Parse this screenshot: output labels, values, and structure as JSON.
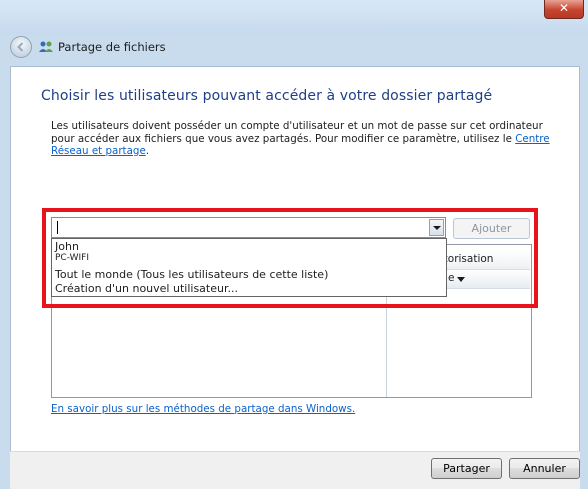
{
  "window": {
    "title": "Partage de fichiers",
    "close_label": "✕"
  },
  "heading": "Choisir les utilisateurs pouvant accéder à votre dossier partagé",
  "description": {
    "text": "Les utilisateurs doivent posséder un compte d'utilisateur et un mot de passe sur cet ordinateur pour accéder aux fichiers que vous avez partagés. Pour modifier ce paramètre, utilisez le ",
    "link": "Centre Réseau et partage",
    "end": "."
  },
  "user_input": {
    "value": ""
  },
  "add_button": "Ajouter",
  "dropdown": {
    "items": [
      "John",
      "PC-WIFI",
      "Tout le monde (Tous les utilisateurs de cette liste)",
      "Création d'un nouvel utilisateur..."
    ]
  },
  "table": {
    "permission_header": "utorisation",
    "permission_value": "e"
  },
  "footer_link": "En savoir plus sur les méthodes de partage dans Windows.",
  "buttons": {
    "share": "Partager",
    "cancel": "Annuler"
  },
  "colors": {
    "highlight": "#e8141c",
    "link": "#0b62c8",
    "heading": "#1e3f87"
  }
}
